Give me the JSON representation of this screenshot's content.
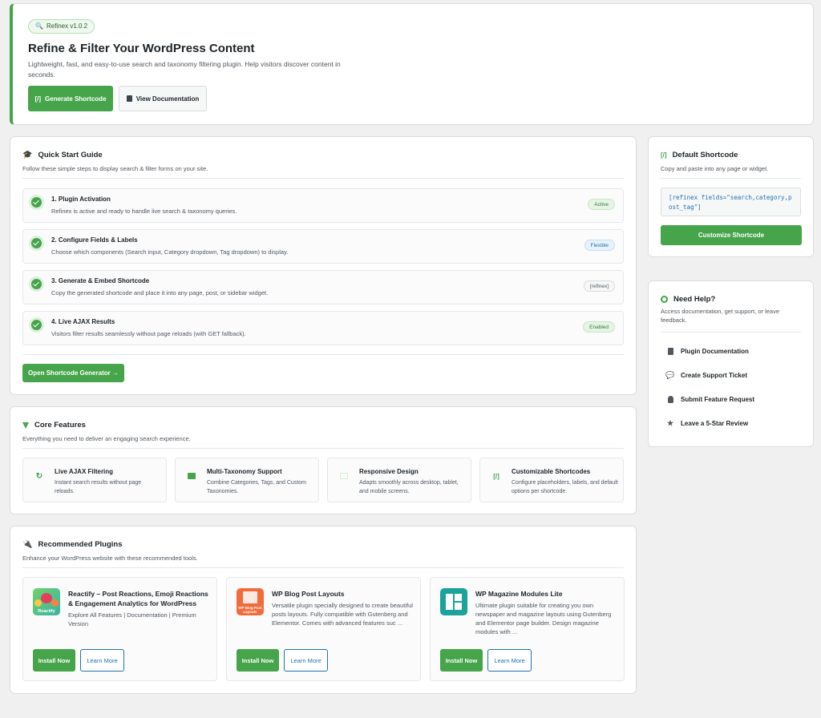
{
  "hero": {
    "version_badge": "Refinex v1.0.2",
    "title": "Refine & Filter Your WordPress Content",
    "description": "Lightweight, fast, and easy-to-use search and taxonomy filtering plugin. Help visitors discover content in seconds.",
    "generate_button": "Generate Shortcode",
    "docs_button": "View Documentation"
  },
  "quick_start": {
    "title": "Quick Start Guide",
    "subtitle": "Follow these simple steps to display search & filter forms on your site.",
    "steps": [
      {
        "title": "1. Plugin Activation",
        "desc": "Refinex is active and ready to handle live search & taxonomy queries.",
        "tag": "Active"
      },
      {
        "title": "2. Configure Fields & Labels",
        "desc": "Choose which components (Search input, Category dropdown, Tag dropdown) to display.",
        "tag": "Flexible"
      },
      {
        "title": "3. Generate & Embed Shortcode",
        "desc": "Copy the generated shortcode and place it into any page, post, or sidebar widget.",
        "tag": "[refinex]"
      },
      {
        "title": "4. Live AJAX Results",
        "desc": "Visitors filter results seamlessly without page reloads (with GET fallback).",
        "tag": "Enabled"
      }
    ],
    "button": "Open Shortcode Generator →"
  },
  "core_features": {
    "title": "Core Features",
    "subtitle": "Everything you need to deliver an engaging search experience.",
    "items": [
      {
        "title": "Live AJAX Filtering",
        "desc": "Instant search results without page reloads."
      },
      {
        "title": "Multi-Taxonomy Support",
        "desc": "Combine Categories, Tags, and Custom Taxonomies."
      },
      {
        "title": "Responsive Design",
        "desc": "Adapts smoothly across desktop, tablet, and mobile screens."
      },
      {
        "title": "Customizable Shortcodes",
        "desc": "Configure placeholders, labels, and default options per shortcode."
      }
    ]
  },
  "recommended": {
    "title": "Recommended Plugins",
    "subtitle": "Enhance your WordPress website with these recommended tools.",
    "plugins": [
      {
        "title": "Reactify – Post Reactions, Emoji Reactions & Engagement Analytics for WordPress",
        "desc": "Explore All Features | Documentation | Premium Version",
        "logo_text": "Reactify"
      },
      {
        "title": "WP Blog Post Layouts",
        "desc": "Versatile plugin specially designed to create beautiful posts layouts. Fully compatible with Gutenberg and Elementor. Comes with advanced features suc ...",
        "logo_text": "WP Blog Post Layouts"
      },
      {
        "title": "WP Magazine Modules Lite",
        "desc": "Ultimate plugin suitable for creating you own newspaper and magazine layouts using Gutenberg and Elementor page builder. Design magazine modules with ...",
        "logo_text": ""
      }
    ],
    "install_label": "Install Now",
    "learn_label": "Learn More"
  },
  "default_shortcode": {
    "title": "Default Shortcode",
    "subtitle": "Copy and paste into any page or widget.",
    "code": "[refinex fields=\"search,category,post_tag\"]",
    "button": "Customize Shortcode"
  },
  "help": {
    "title": "Need Help?",
    "subtitle": "Access documentation, get support, or leave feedback.",
    "items": [
      "Plugin Documentation",
      "Create Support Ticket",
      "Submit Feature Request",
      "Leave a 5-Star Review"
    ]
  },
  "colors": {
    "accent": "#46a44a",
    "link": "#2271b1"
  }
}
